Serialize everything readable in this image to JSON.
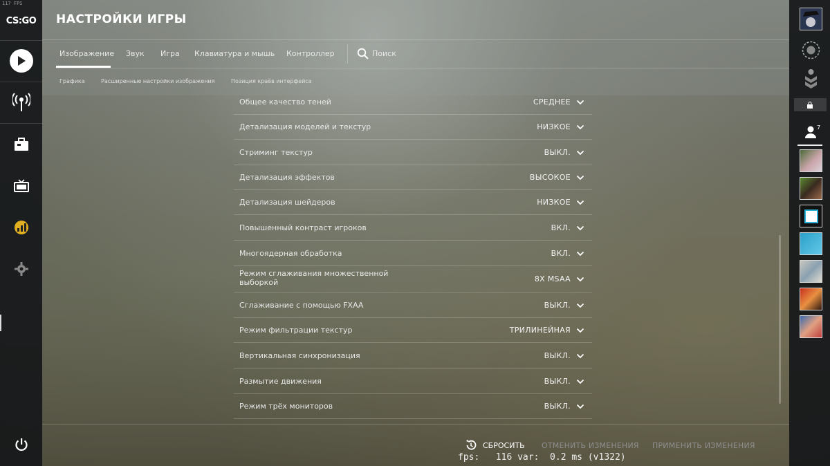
{
  "overlay_fps": "117 FPS",
  "logo": "CS:GO",
  "header": {
    "title": "НАСТРОЙКИ ИГРЫ",
    "tabs": [
      "Изображение",
      "Звук",
      "Игра",
      "Клавиатура и мышь",
      "Контроллер"
    ],
    "active_tab": "Изображение",
    "search_label": "Поиск",
    "subtabs": [
      "Графика",
      "Расширенные настройки изображения",
      "Позиция краёв интерфейса"
    ]
  },
  "settings": [
    {
      "label": "Общее качество теней",
      "value": "СРЕДНЕЕ"
    },
    {
      "label": "Детализация моделей и текстур",
      "value": "НИЗКОЕ"
    },
    {
      "label": "Стриминг текстур",
      "value": "ВЫКЛ."
    },
    {
      "label": "Детализация эффектов",
      "value": "ВЫСОКОЕ"
    },
    {
      "label": "Детализация шейдеров",
      "value": "НИЗКОЕ"
    },
    {
      "label": "Повышенный контраст игроков",
      "value": "ВКЛ."
    },
    {
      "label": "Многоядерная обработка",
      "value": "ВКЛ."
    },
    {
      "label": "Режим сглаживания множественной выборкой",
      "value": "8X MSAA"
    },
    {
      "label": "Сглаживание с помощью FXAA",
      "value": "ВЫКЛ."
    },
    {
      "label": "Режим фильтрации текстур",
      "value": "ТРИЛИНЕЙНАЯ"
    },
    {
      "label": "Вертикальная синхронизация",
      "value": "ВЫКЛ."
    },
    {
      "label": "Размытие движения",
      "value": "ВЫКЛ."
    },
    {
      "label": "Режим трёх мониторов",
      "value": "ВЫКЛ."
    }
  ],
  "footer": {
    "reset": "СБРОСИТЬ",
    "cancel": "ОТМЕНИТЬ ИЗМЕНЕНИЯ",
    "apply": "ПРИМЕНИТЬ ИЗМЕНЕНИЯ",
    "fps_readout": "fps:   116 var:  0.2 ms (v1322)"
  },
  "friends": {
    "count": "7"
  },
  "icons": {
    "play": "play-icon",
    "broadcast": "broadcast-icon",
    "inventory": "briefcase-icon",
    "watch": "tv-icon",
    "stats": "stats-icon",
    "settings": "gear-icon",
    "power": "power-icon",
    "search": "search-icon",
    "reset": "reset-icon"
  },
  "colors": {
    "panel": "#16181a",
    "active_text": "#ffffff",
    "disabled_text": "#8f8f8f"
  }
}
